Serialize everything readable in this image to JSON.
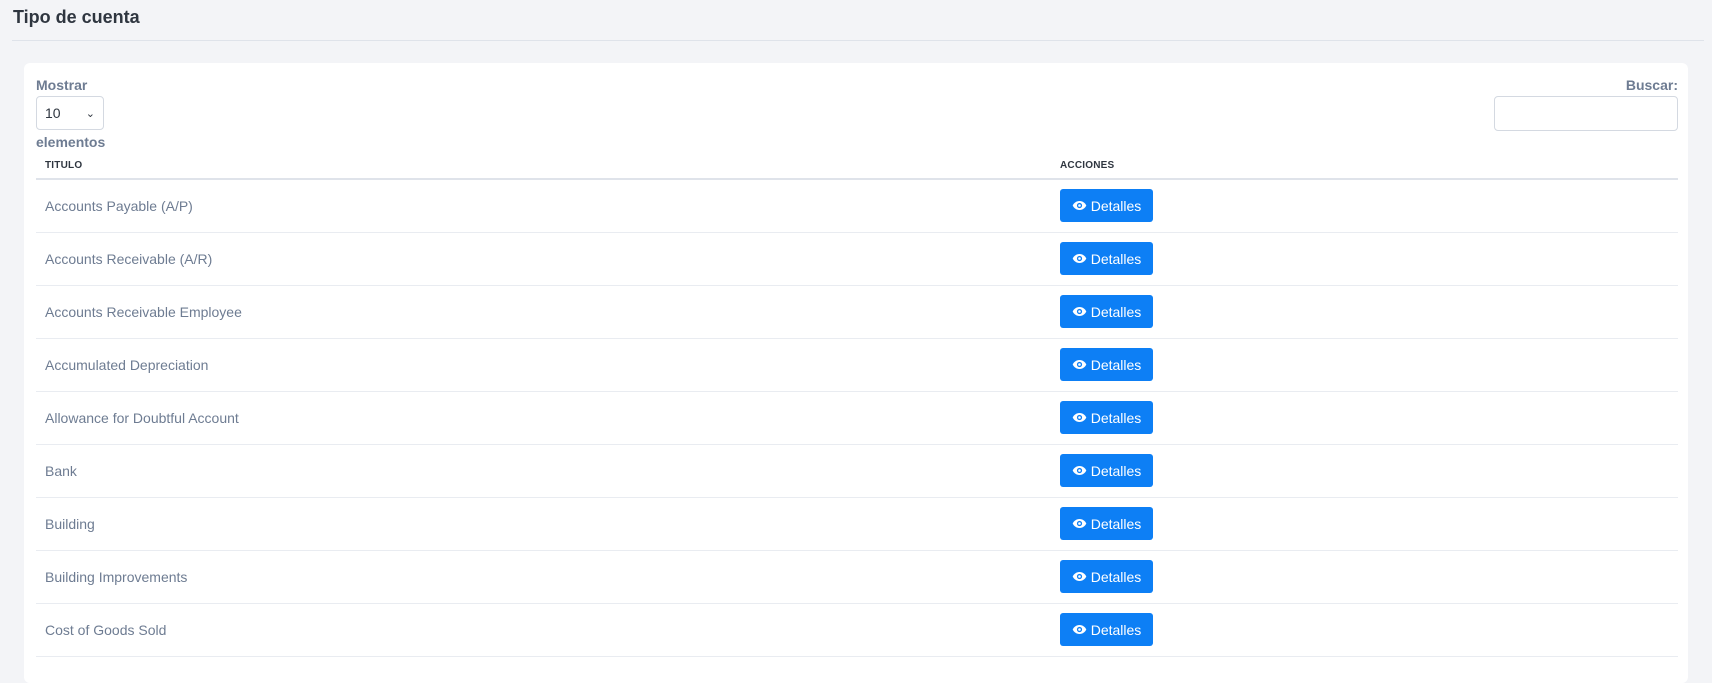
{
  "header": {
    "title": "Tipo de cuenta"
  },
  "length": {
    "label": "Mostrar",
    "value": "10",
    "suffix": "elementos"
  },
  "search": {
    "label": "Buscar:",
    "value": ""
  },
  "table": {
    "columns": [
      "TITULO",
      "ACCIONES"
    ],
    "action_label": "Detalles",
    "action_icon": "eye-icon",
    "rows": [
      {
        "title": "Accounts Payable (A/P)"
      },
      {
        "title": "Accounts Receivable (A/R)"
      },
      {
        "title": "Accounts Receivable Employee"
      },
      {
        "title": "Accumulated Depreciation"
      },
      {
        "title": "Allowance for Doubtful Account"
      },
      {
        "title": "Bank"
      },
      {
        "title": "Building"
      },
      {
        "title": "Building Improvements"
      },
      {
        "title": "Cost of Goods Sold"
      }
    ]
  },
  "colors": {
    "accent": "#0d7ff5",
    "background": "#f3f4f7",
    "text_muted": "#6e7c92"
  }
}
